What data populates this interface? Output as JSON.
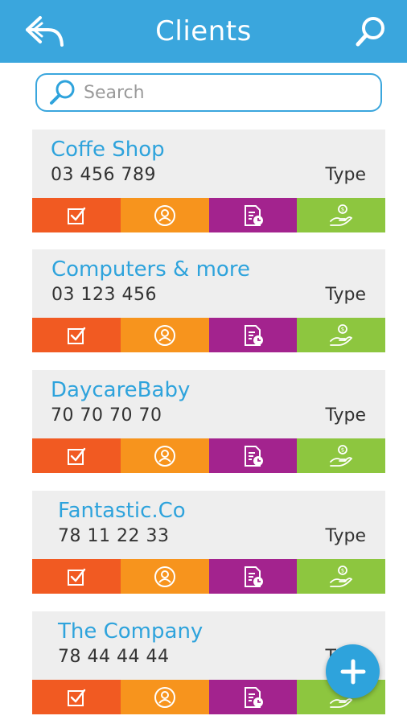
{
  "header": {
    "title": "Clients",
    "back_icon": "back-arrow-icon",
    "search_icon": "search-icon",
    "background": "#3aa6dd"
  },
  "search": {
    "placeholder": "Search",
    "value": ""
  },
  "clients": [
    {
      "name": "Coffe Shop",
      "phone": "03 456 789",
      "type": "Type"
    },
    {
      "name": "Computers & more",
      "phone": "03 123 456",
      "type": "Type"
    },
    {
      "name": "DaycareBaby",
      "phone": "70 70 70 70",
      "type": "Type"
    },
    {
      "name": "Fantastic.Co",
      "phone": "78 11 22 33",
      "type": "Type"
    },
    {
      "name": "The Company",
      "phone": "78 44 44 44",
      "type": "Type"
    }
  ],
  "actions": [
    {
      "icon": "checkbox-icon",
      "color": "#f15a22"
    },
    {
      "icon": "contact-icon",
      "color": "#f7941d"
    },
    {
      "icon": "document-clock-icon",
      "color": "#a3238e"
    },
    {
      "icon": "hand-coin-icon",
      "color": "#8dc63f"
    }
  ],
  "fab": {
    "icon": "plus-icon",
    "color": "#2ea3dc"
  }
}
